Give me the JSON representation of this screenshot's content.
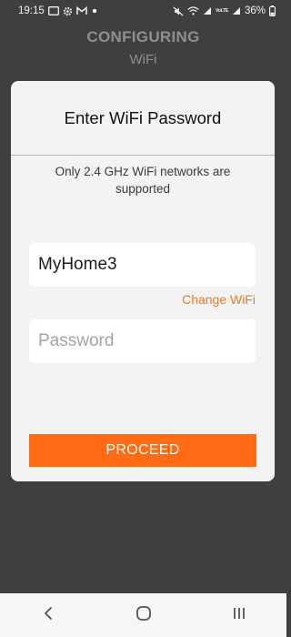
{
  "status_bar": {
    "time": "19:15",
    "battery_percent": "36%",
    "signal_label": "VoLTE",
    "icons_left": [
      "screenshot-icon",
      "settings-gear-icon",
      "gmail-icon",
      "notification-dot-icon"
    ],
    "icons_right": [
      "mute-icon",
      "wifi-icon",
      "signal-icon",
      "signal-icon",
      "battery-icon"
    ]
  },
  "header": {
    "title": "CONFIGURING",
    "subtitle": "WiFi"
  },
  "dialog": {
    "title": "Enter WiFi Password",
    "note": "Only 2.4 GHz WiFi networks are supported",
    "ssid_value": "MyHome3",
    "change_wifi_label": "Change WiFi",
    "password_placeholder": "Password",
    "password_value": "",
    "proceed_label": "PROCEED"
  },
  "nav_bar": {
    "buttons": [
      "back-icon",
      "home-icon",
      "recents-icon"
    ]
  },
  "colors": {
    "background": "#3f3f3f",
    "dialog": "#f3f3f3",
    "accent": "#ff6a13",
    "link": "#ec7b1e"
  }
}
